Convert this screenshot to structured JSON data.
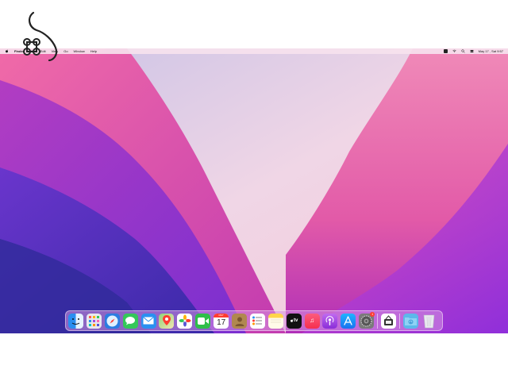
{
  "menubar": {
    "app_name": "Finder",
    "menus": [
      "File",
      "Edit",
      "View",
      "Go",
      "Window",
      "Help"
    ],
    "datetime": "May 17 , Sat 9:57"
  },
  "dock": {
    "apps": [
      {
        "name": "Finder",
        "color": "#1e8cf0"
      },
      {
        "name": "Launchpad",
        "color": "#e8e8ee"
      },
      {
        "name": "Safari",
        "color": "#2a7de1"
      },
      {
        "name": "Messages",
        "color": "#34c759"
      },
      {
        "name": "Mail",
        "color": "#2a90f0"
      },
      {
        "name": "Maps",
        "color": "#6ccf6a"
      },
      {
        "name": "Photos",
        "color": "#ffffff"
      },
      {
        "name": "FaceTime",
        "color": "#2fbf4a"
      },
      {
        "name": "Calendar",
        "color": "#ffffff"
      },
      {
        "name": "Contacts",
        "color": "#b08850"
      },
      {
        "name": "Reminders",
        "color": "#ffffff"
      },
      {
        "name": "Notes",
        "color": "#fff4b0"
      },
      {
        "name": "TV",
        "color": "#111111"
      },
      {
        "name": "Music",
        "color": "#fa3c55"
      },
      {
        "name": "Podcasts",
        "color": "#a04de0"
      },
      {
        "name": "App Store",
        "color": "#1a8af5"
      },
      {
        "name": "System Preferences",
        "color": "#7a7a7a"
      },
      {
        "name": "Preview",
        "color": "#ffffff"
      },
      {
        "name": "Downloads",
        "color": "#5cb8ea"
      },
      {
        "name": "Trash",
        "color": "#dcdce4"
      }
    ],
    "calendar": {
      "month": "MAY",
      "day": "17"
    },
    "tv_label": "tv",
    "sysprefs_badge": "1"
  }
}
